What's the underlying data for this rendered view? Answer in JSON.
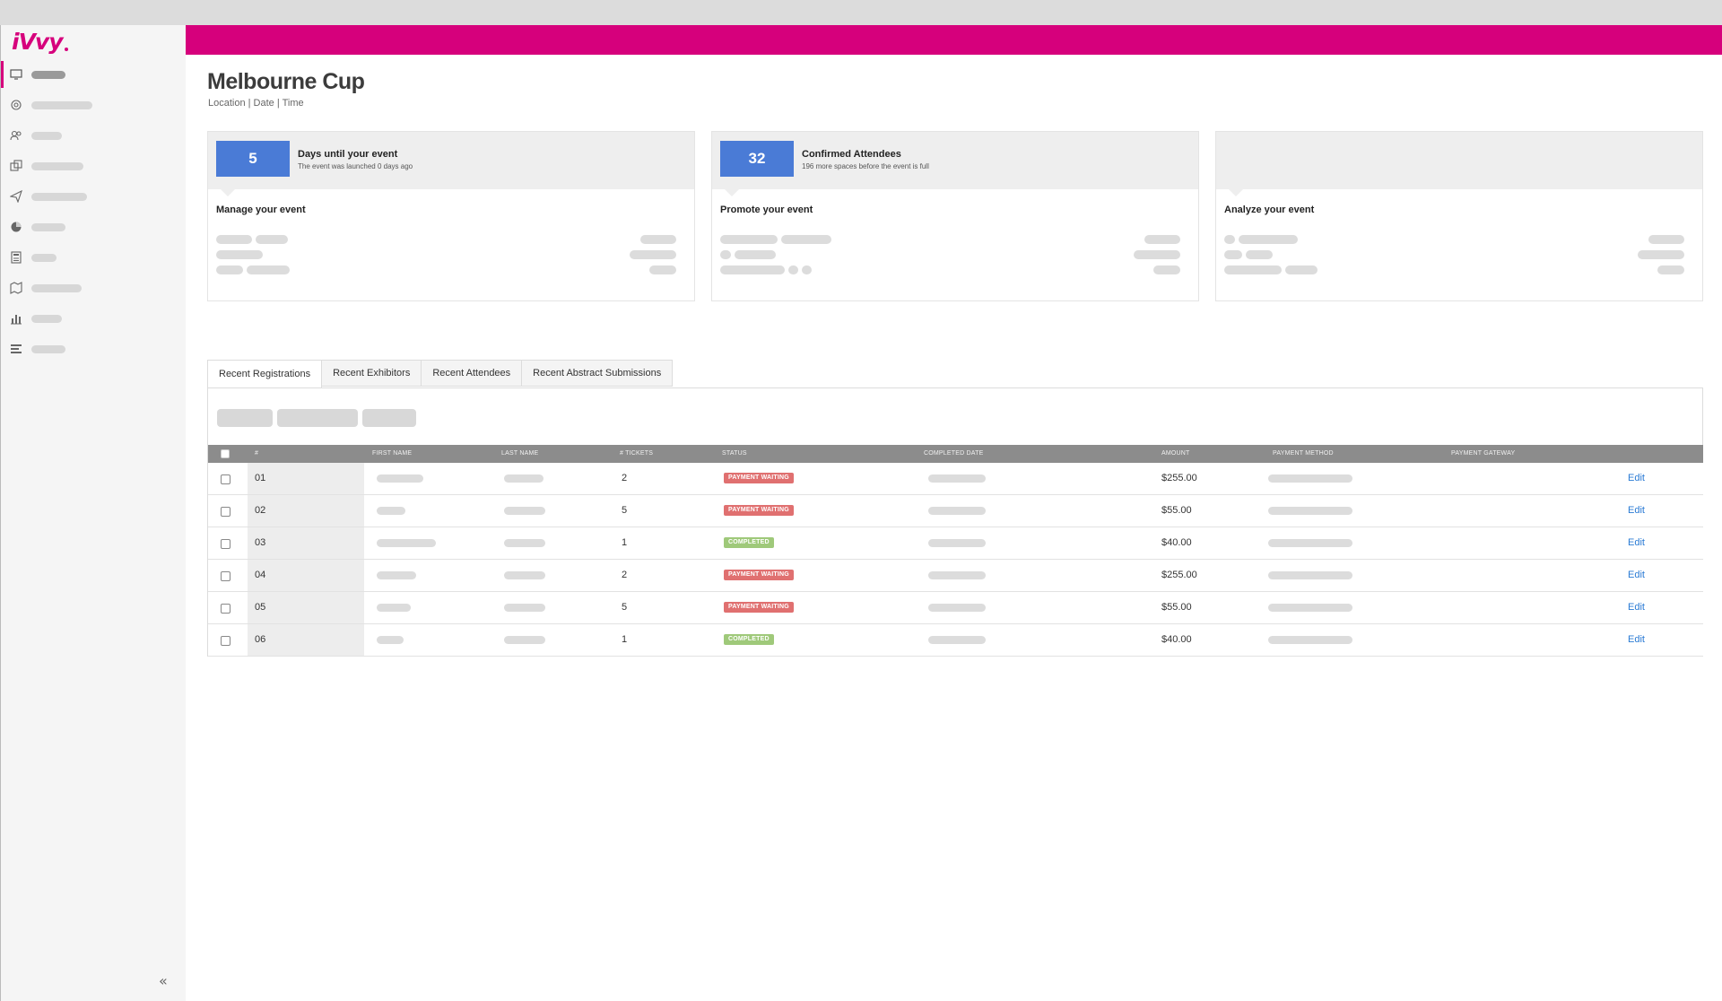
{
  "app": {
    "logo_text": "iVvy"
  },
  "sidebar": {
    "items": [
      {
        "icon": "monitor-icon",
        "active": true
      },
      {
        "icon": "target-icon",
        "active": false
      },
      {
        "icon": "users-icon",
        "active": false
      },
      {
        "icon": "copy-icon",
        "active": false
      },
      {
        "icon": "send-icon",
        "active": false
      },
      {
        "icon": "pie-chart-icon",
        "active": false
      },
      {
        "icon": "calculator-icon",
        "active": false
      },
      {
        "icon": "map-icon",
        "active": false
      },
      {
        "icon": "bar-chart-icon",
        "active": false
      },
      {
        "icon": "list-icon",
        "active": false
      }
    ],
    "collapse_label": "«"
  },
  "header": {
    "title": "Melbourne Cup",
    "subtitle": "Location | Date | Time"
  },
  "cards": [
    {
      "number": "5",
      "title": "Days until your event",
      "subtitle": "The event was launched 0 days ago",
      "section": "Manage your event"
    },
    {
      "number": "32",
      "title": "Confirmed Attendees",
      "subtitle": "196 more spaces before the event is full",
      "section": "Promote your event"
    },
    {
      "number": "",
      "title": "",
      "subtitle": "",
      "section": "Analyze your event"
    }
  ],
  "tabs": [
    "Recent Registrations",
    "Recent Exhibitors",
    "Recent Attendees",
    "Recent Abstract Submissions"
  ],
  "table": {
    "columns": [
      "#",
      "First Name",
      "Last Name",
      "# Tickets",
      "Status",
      "Completed Date",
      "Amount",
      "Payment Method",
      "Payment Gateway"
    ],
    "rows": [
      {
        "id": "01",
        "tickets": "2",
        "status": "PAYMENT WAITING",
        "status_type": "waiting",
        "amount": "$255.00",
        "action": "Edit"
      },
      {
        "id": "02",
        "tickets": "5",
        "status": "PAYMENT WAITING",
        "status_type": "waiting",
        "amount": "$55.00",
        "action": "Edit"
      },
      {
        "id": "03",
        "tickets": "1",
        "status": "COMPLETED",
        "status_type": "completed",
        "amount": "$40.00",
        "action": "Edit"
      },
      {
        "id": "04",
        "tickets": "2",
        "status": "PAYMENT WAITING",
        "status_type": "waiting",
        "amount": "$255.00",
        "action": "Edit"
      },
      {
        "id": "05",
        "tickets": "5",
        "status": "PAYMENT WAITING",
        "status_type": "waiting",
        "amount": "$55.00",
        "action": "Edit"
      },
      {
        "id": "06",
        "tickets": "1",
        "status": "COMPLETED",
        "status_type": "completed",
        "amount": "$40.00",
        "action": "Edit"
      }
    ]
  },
  "colors": {
    "brand": "#d6007c",
    "accent_blue": "#4a7bd6",
    "link": "#2a7bd4",
    "status_waiting": "#e07070",
    "status_completed": "#9fc97a"
  }
}
